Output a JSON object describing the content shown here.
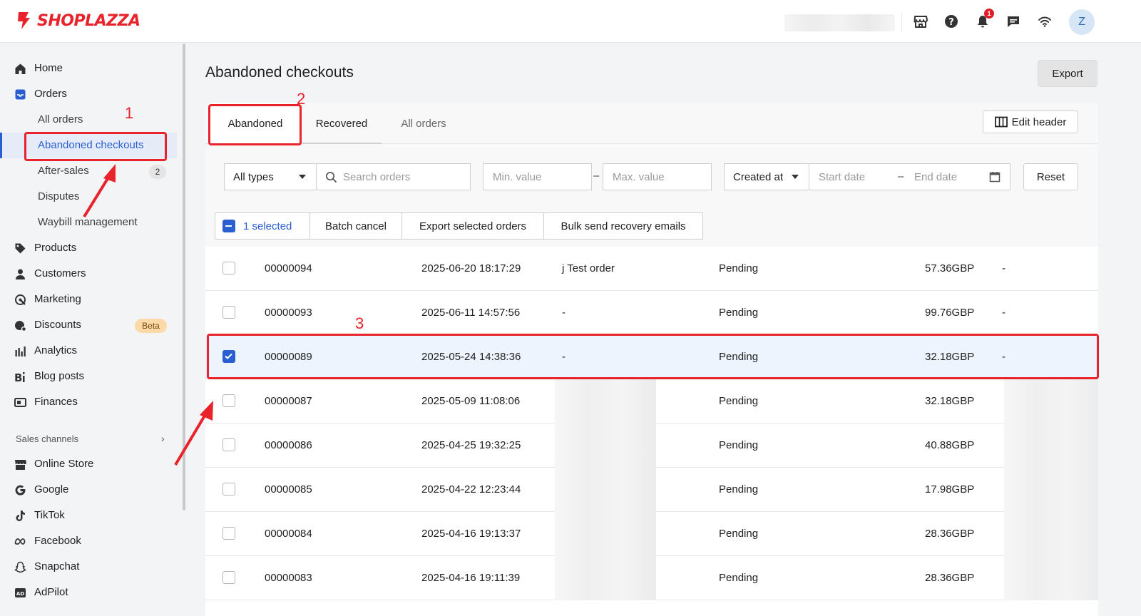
{
  "brand": {
    "name": "SHOPLAZZA",
    "color": "#e8232b"
  },
  "topbar": {
    "icons": [
      "store-icon",
      "help-icon",
      "bell-icon",
      "chat-icon",
      "wifi-icon"
    ],
    "notification_count": "1",
    "avatar_letter": "Z"
  },
  "sidebar": {
    "items": [
      {
        "label": "Home",
        "icon": "home-icon"
      },
      {
        "label": "Orders",
        "icon": "orders-icon"
      }
    ],
    "orders_sub": [
      {
        "label": "All orders"
      },
      {
        "label": "Abandoned checkouts",
        "active": true
      },
      {
        "label": "After-sales",
        "badge": "2"
      },
      {
        "label": "Disputes"
      },
      {
        "label": "Waybill management"
      }
    ],
    "items2": [
      {
        "label": "Products",
        "icon": "tag-icon"
      },
      {
        "label": "Customers",
        "icon": "person-icon"
      },
      {
        "label": "Marketing",
        "icon": "marketing-icon"
      },
      {
        "label": "Discounts",
        "icon": "discount-icon",
        "badge": "Beta"
      },
      {
        "label": "Analytics",
        "icon": "analytics-icon"
      },
      {
        "label": "Blog posts",
        "icon": "blog-icon"
      },
      {
        "label": "Finances",
        "icon": "finance-icon"
      }
    ],
    "section_label": "Sales channels",
    "channels": [
      {
        "label": "Online Store",
        "icon": "store-icon"
      },
      {
        "label": "Google",
        "icon": "google-icon"
      },
      {
        "label": "TikTok",
        "icon": "tiktok-icon"
      },
      {
        "label": "Facebook",
        "icon": "meta-icon"
      },
      {
        "label": "Snapchat",
        "icon": "snapchat-icon"
      },
      {
        "label": "AdPilot",
        "icon": "adpilot-icon"
      }
    ]
  },
  "page": {
    "title": "Abandoned checkouts",
    "export_label": "Export"
  },
  "tabs": [
    {
      "label": "Abandoned",
      "active": true
    },
    {
      "label": "Recovered"
    },
    {
      "label": "All orders"
    }
  ],
  "edit_header_label": "Edit header",
  "filters": {
    "type_select": "All types",
    "search_placeholder": "Search orders",
    "min_placeholder": "Min. value",
    "max_placeholder": "Max. value",
    "date_select": "Created at",
    "start_placeholder": "Start date",
    "end_placeholder": "End date",
    "reset_label": "Reset"
  },
  "batch": {
    "selected_label": "1 selected",
    "cancel_label": "Batch cancel",
    "export_label": "Export selected orders",
    "email_label": "Bulk send recovery emails"
  },
  "orders": [
    {
      "id": "00000094",
      "date": "2025-06-20 18:17:29",
      "note": "j Test order",
      "status": "Pending",
      "amount": "57.36GBP",
      "extra": "-",
      "checked": false
    },
    {
      "id": "00000093",
      "date": "2025-06-11 14:57:56",
      "note": "-",
      "status": "Pending",
      "amount": "99.76GBP",
      "extra": "-",
      "checked": false
    },
    {
      "id": "00000089",
      "date": "2025-05-24 14:38:36",
      "note": "-",
      "status": "Pending",
      "amount": "32.18GBP",
      "extra": "-",
      "checked": true
    },
    {
      "id": "00000087",
      "date": "2025-05-09 11:08:06",
      "note": "",
      "status": "Pending",
      "amount": "32.18GBP",
      "extra": "",
      "checked": false
    },
    {
      "id": "00000086",
      "date": "2025-04-25 19:32:25",
      "note": "",
      "status": "Pending",
      "amount": "40.88GBP",
      "extra": "",
      "checked": false
    },
    {
      "id": "00000085",
      "date": "2025-04-22 12:23:44",
      "note": "",
      "status": "Pending",
      "amount": "17.98GBP",
      "extra": "",
      "checked": false
    },
    {
      "id": "00000084",
      "date": "2025-04-16 19:13:37",
      "note": "",
      "status": "Pending",
      "amount": "28.36GBP",
      "extra": "",
      "checked": false
    },
    {
      "id": "00000083",
      "date": "2025-04-16 19:11:39",
      "note": "",
      "status": "Pending",
      "amount": "28.36GBP",
      "extra": "",
      "checked": false
    }
  ],
  "annotations": [
    "1",
    "2",
    "3"
  ],
  "colors": {
    "accent": "#2a5fd1",
    "annotation": "#e8232b"
  }
}
